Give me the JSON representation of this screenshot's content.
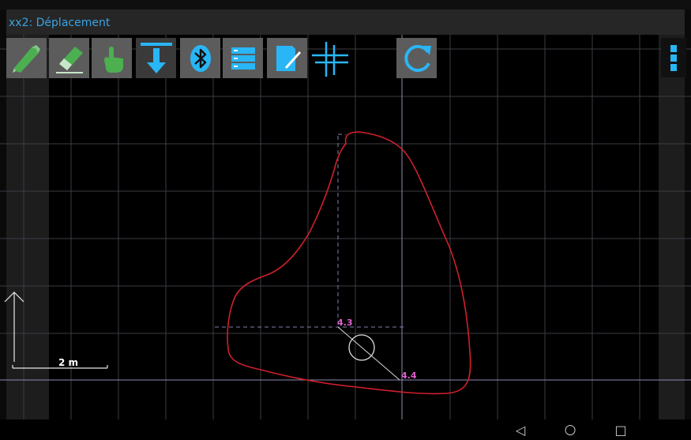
{
  "title": "xx2: Déplacement",
  "toolbar": {
    "buttons": [
      {
        "name": "pencil-icon",
        "color": "#4caf50"
      },
      {
        "name": "eraser-icon",
        "color": "#4caf50"
      },
      {
        "name": "hand-pointer-icon",
        "color": "#4caf50"
      },
      {
        "name": "download-arrow-icon",
        "color": "#29b6f6"
      },
      {
        "name": "bluetooth-icon",
        "color": "#29b6f6"
      },
      {
        "name": "list-icon",
        "color": "#29b6f6"
      },
      {
        "name": "edit-document-icon",
        "color": "#29b6f6"
      },
      {
        "name": "crosshair-icon",
        "color": "#29b6f6"
      },
      {
        "name": "refresh-icon",
        "color": "#29b6f6"
      }
    ],
    "menu_icon": "more-vert-icon"
  },
  "drawing": {
    "point_labels": {
      "a": "4.3",
      "b": "4.4"
    },
    "scale_label": "2 m",
    "shape_color": "#d0202c",
    "label_color": "#e060d0"
  },
  "navigation": {
    "back": "◁",
    "home": "○",
    "recents": "□"
  },
  "colors": {
    "accent": "#29b6f6",
    "green": "#4caf50",
    "title": "#3aa3e3"
  }
}
